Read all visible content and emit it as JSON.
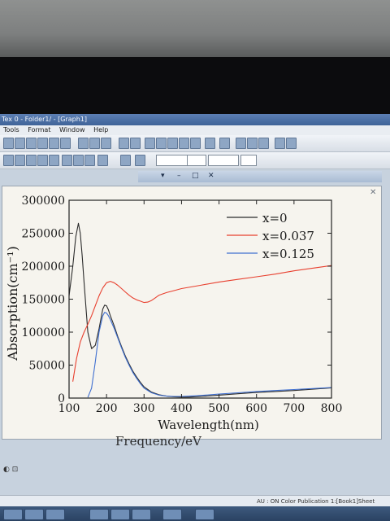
{
  "window": {
    "title": "Tex 0 - Folder1/ - [Graph1]",
    "menus": [
      "Tools",
      "Format",
      "Window",
      "Help"
    ]
  },
  "graph_window": {
    "controls": [
      "▾",
      "–",
      "□",
      "✕"
    ]
  },
  "status": {
    "text": "AU : ON   Color Publication   1:[Book1]Sheet"
  },
  "below_text": "Frequency/eV",
  "colors": {
    "series_x0": "#2b2b2b",
    "series_x0037": "#e8402f",
    "series_x0125": "#3f6fd0",
    "plot_bg": "#f6f4ee"
  },
  "chart_data": {
    "type": "line",
    "xlabel": "Wavelength(nm)",
    "ylabel": "Absorption(cm⁻¹)",
    "xlim": [
      100,
      800
    ],
    "ylim": [
      0,
      300000
    ],
    "xticks": [
      100,
      200,
      300,
      400,
      500,
      600,
      700,
      800
    ],
    "yticks": [
      0,
      50000,
      100000,
      150000,
      200000,
      250000,
      300000
    ],
    "legend_position": "top-right",
    "series": [
      {
        "name": "x=0",
        "color": "#2b2b2b",
        "x": [
          100,
          110,
          118,
          125,
          130,
          135,
          140,
          150,
          160,
          170,
          180,
          190,
          195,
          200,
          205,
          210,
          220,
          230,
          240,
          250,
          260,
          270,
          280,
          290,
          300,
          320,
          340,
          360,
          380,
          400,
          420,
          450,
          500,
          550,
          600,
          650,
          700,
          750,
          800
        ],
        "y": [
          155000,
          200000,
          245000,
          265000,
          250000,
          215000,
          175000,
          100000,
          75000,
          80000,
          105000,
          135000,
          141000,
          140000,
          134000,
          125000,
          110000,
          93000,
          78000,
          64000,
          52000,
          41000,
          32000,
          24000,
          17000,
          9000,
          5000,
          3000,
          2000,
          1500,
          1500,
          2500,
          4500,
          6500,
          8500,
          10000,
          11500,
          13500,
          15500
        ]
      },
      {
        "name": "x=0.037",
        "color": "#e8402f",
        "x": [
          110,
          120,
          130,
          140,
          150,
          160,
          170,
          180,
          190,
          200,
          210,
          220,
          230,
          240,
          250,
          260,
          270,
          280,
          290,
          300,
          310,
          320,
          330,
          340,
          360,
          380,
          400,
          450,
          500,
          550,
          600,
          650,
          700,
          750,
          800
        ],
        "y": [
          25000,
          60000,
          85000,
          100000,
          112000,
          125000,
          140000,
          155000,
          167000,
          175000,
          177000,
          175000,
          171000,
          166000,
          161000,
          156000,
          152000,
          149000,
          147000,
          145000,
          145500,
          148000,
          152000,
          156000,
          160000,
          163000,
          166000,
          171000,
          176000,
          180000,
          184000,
          188000,
          193000,
          197000,
          201000
        ]
      },
      {
        "name": "x=0.125",
        "color": "#3f6fd0",
        "x": [
          150,
          160,
          170,
          180,
          190,
          195,
          200,
          205,
          210,
          220,
          230,
          240,
          250,
          260,
          270,
          280,
          290,
          300,
          320,
          340,
          360,
          380,
          400,
          420,
          450,
          500,
          550,
          600,
          650,
          700,
          750,
          800
        ],
        "y": [
          1000,
          15000,
          55000,
          100000,
          125000,
          130000,
          129000,
          125000,
          119000,
          106000,
          91000,
          76000,
          62000,
          50000,
          39000,
          30000,
          22000,
          15000,
          8000,
          4500,
          3000,
          2500,
          2500,
          3000,
          4000,
          6000,
          8000,
          10000,
          11500,
          13000,
          14500,
          16000
        ]
      }
    ]
  }
}
